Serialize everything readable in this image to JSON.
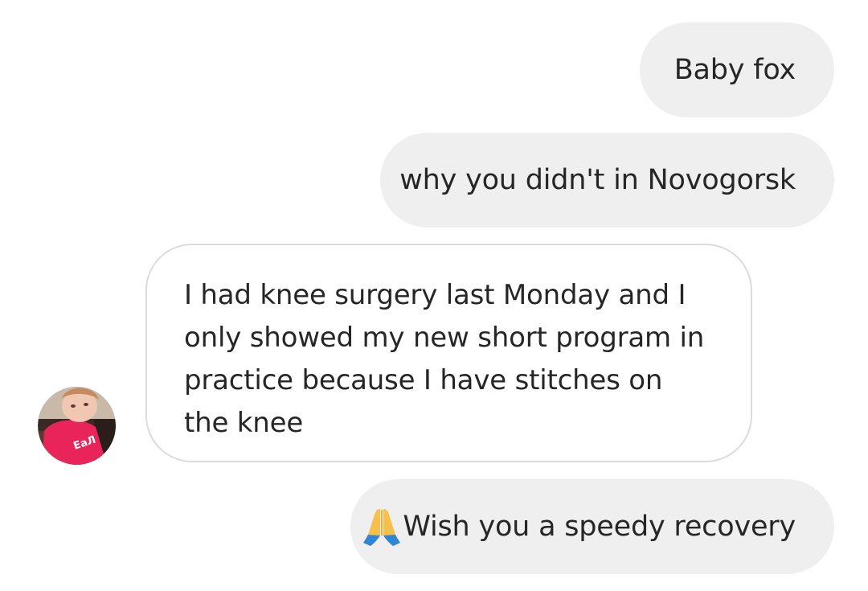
{
  "conversation": {
    "messages": [
      {
        "direction": "outgoing",
        "text": "Baby fox"
      },
      {
        "direction": "outgoing",
        "text": "why you didn't in Novogorsk"
      },
      {
        "direction": "incoming",
        "text": "I had knee surgery last Monday and I only showed my new short program in practice because I have stitches on the knee"
      },
      {
        "direction": "outgoing",
        "emoji": "folded-hands-icon",
        "text": "Wish you a speedy recovery"
      }
    ],
    "avatar": {
      "shirt_print": "EaЛ"
    }
  },
  "colors": {
    "outgoing_bubble": "#efefef",
    "incoming_border": "#dbdbdb",
    "text": "#262626",
    "avatar_shirt": "#e8245a"
  }
}
